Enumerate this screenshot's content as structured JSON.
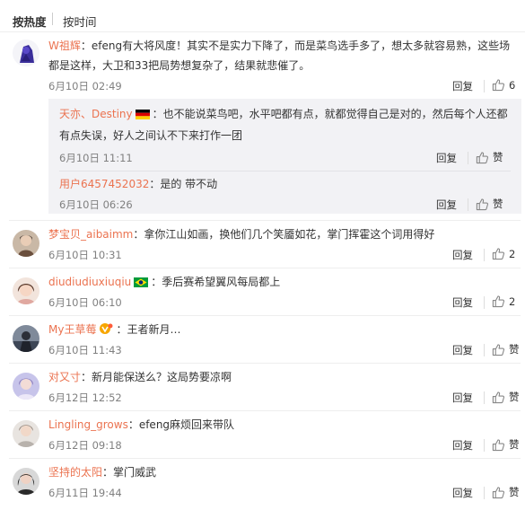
{
  "sort": {
    "hot_label": "按热度",
    "time_label": "按时间"
  },
  "actions": {
    "reply_label": "回复",
    "like_label": "赞"
  },
  "comments": [
    {
      "username": "W祖辉",
      "text": "：efeng有大将风度！其实不是实力下降了，而是菜鸟选手多了，想太多就容易熟，这些场都是这样，大卫和33把局势想复杂了，结果就悲催了。",
      "date": "6月10日 02:49",
      "likes": "6",
      "replies": [
        {
          "username": "天亦、Destiny",
          "text": "：也不能说菜鸟吧，水平吧都有点，就都觉得自己是对的，然后每个人还都有点失误，好人之间认不下来打作一团",
          "date": "6月10日 11:11"
        },
        {
          "username": "用户6457452032",
          "text": "：是的   带不动",
          "date": "6月10日 06:26"
        }
      ]
    },
    {
      "username": "梦宝贝_aibaimm",
      "text": "：拿你江山如画，换他们几个笑靥如花，掌门挥霍这个词用得好",
      "date": "6月10日 10:31",
      "likes": "2"
    },
    {
      "username": "diudiudiuxiuqiu",
      "text": "：季后赛希望翼风每局都上",
      "date": "6月10日 06:10",
      "likes": "2"
    },
    {
      "username": "My王草莓",
      "text": "：王者新月…",
      "date": "6月10日 11:43",
      "likes": ""
    },
    {
      "username": "对又寸",
      "text": "：新月能保送么？这局势要凉啊",
      "date": "6月12日 12:52",
      "likes": ""
    },
    {
      "username": "Lingling_grows",
      "text": "：efeng麻烦回来带队",
      "date": "6月12日 09:18",
      "likes": ""
    },
    {
      "username": "坚持的太阳",
      "text": "：掌门威武",
      "date": "6月11日 19:44",
      "likes": ""
    }
  ]
}
